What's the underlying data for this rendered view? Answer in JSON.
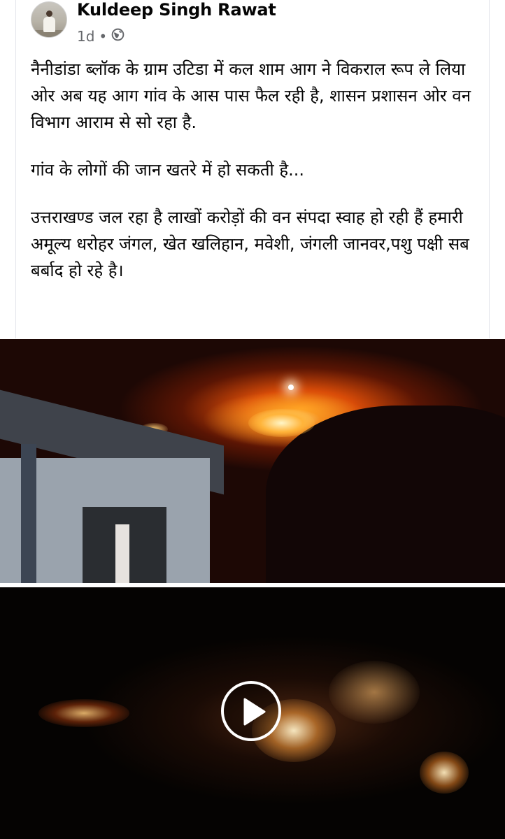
{
  "post": {
    "author": "Kuldeep Singh Rawat",
    "time": "1d",
    "separator": "•",
    "audience_icon": "globe-icon",
    "paragraphs": [
      "नैनीडांडा ब्लॉक के ग्राम उटिडा में कल शाम आग ने विकराल रूप ले लिया ओर अब यह आग गांव के आस पास फैल रही है, शासन प्रशासन ओर वन विभाग आराम से सो रहा है.",
      "गांव के लोगों की जान खतरे में हो सकती है...",
      "उत्तराखण्ड जल रहा है लाखों करोड़ों की वन संपदा स्वाह हो रही हैं हमारी अमूल्य धरोहर जंगल, खेत खलिहान, मवेशी, जंगली जानवर,पशु पक्षी सब बर्बाद हो रहे है।"
    ]
  },
  "media": {
    "play_icon": "play-icon"
  }
}
